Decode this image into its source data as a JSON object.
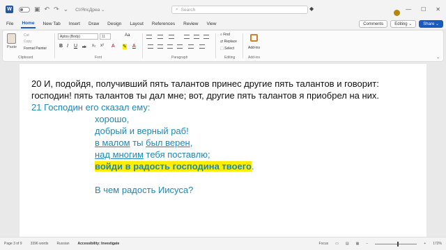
{
  "app": {
    "icon_letter": "W",
    "doc_title": "CI/ЯпсДpea ⌄",
    "search_placeholder": "Search"
  },
  "titlebar": {
    "minimize": "—",
    "maximize": "☐",
    "close": "✕"
  },
  "tabs": [
    "File",
    "Home",
    "New Tab",
    "Insert",
    "Draw",
    "Design",
    "Layout",
    "References",
    "Review",
    "View"
  ],
  "active_tab": "Home",
  "ribbon_right": {
    "comments": "Comments",
    "editing": "Editing ⌄",
    "share": "Share ⌄"
  },
  "ribbon": {
    "clipboard": {
      "paste": "Paste",
      "cut": "Cut",
      "copy": "Copy",
      "format_painter": "Format Painter",
      "label": "Clipboard"
    },
    "font": {
      "name": "Aptos (Body)",
      "size": "11",
      "bold": "B",
      "italic": "I",
      "underline": "U",
      "strike": "ab",
      "sub": "x₂",
      "sup": "x²",
      "case": "Aa",
      "label": "Font"
    },
    "paragraph": {
      "label": "Paragraph"
    },
    "editing": {
      "find": "Find",
      "replace": "Replace",
      "select": "Select",
      "label": "Editing"
    },
    "addins": {
      "label": "Add-ins",
      "group_label": "Add-ins"
    }
  },
  "document": {
    "line1": "20 И, подойдя, получивший пять талантов принес другие пять талантов и говорит:",
    "line2": "господин! пять талантов ты дал мне; вот, другие пять талантов я приобрел на них.",
    "line3": "21 Господин его сказал ему:",
    "line4": "хорошо,",
    "line5": "добрый и верный раб!",
    "line6_a": "в малом",
    "line6_b": " ты ",
    "line6_c": "был верен",
    "line6_d": ",",
    "line7_a": "над многим",
    "line7_b": " тебя поставлю;",
    "line8": "войди в радость господина твоего",
    "line8_end": ".",
    "line10": "В чем радость Иисуса?"
  },
  "status": {
    "page": "Page 3 of 9",
    "words": "3396 words",
    "language": "Russian",
    "accessibility": "Accessibility: Investigate",
    "focus": "Focus",
    "zoom": "172%"
  }
}
